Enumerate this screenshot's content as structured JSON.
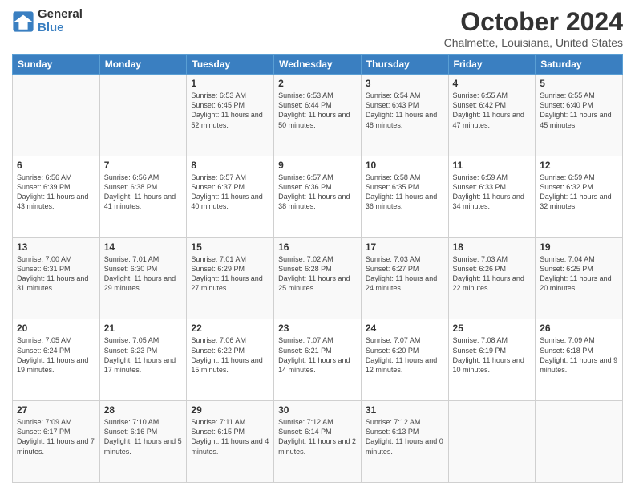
{
  "header": {
    "logo_general": "General",
    "logo_blue": "Blue",
    "month": "October 2024",
    "location": "Chalmette, Louisiana, United States"
  },
  "days_of_week": [
    "Sunday",
    "Monday",
    "Tuesday",
    "Wednesday",
    "Thursday",
    "Friday",
    "Saturday"
  ],
  "weeks": [
    [
      {
        "day": "",
        "info": ""
      },
      {
        "day": "",
        "info": ""
      },
      {
        "day": "1",
        "info": "Sunrise: 6:53 AM\nSunset: 6:45 PM\nDaylight: 11 hours and 52 minutes."
      },
      {
        "day": "2",
        "info": "Sunrise: 6:53 AM\nSunset: 6:44 PM\nDaylight: 11 hours and 50 minutes."
      },
      {
        "day": "3",
        "info": "Sunrise: 6:54 AM\nSunset: 6:43 PM\nDaylight: 11 hours and 48 minutes."
      },
      {
        "day": "4",
        "info": "Sunrise: 6:55 AM\nSunset: 6:42 PM\nDaylight: 11 hours and 47 minutes."
      },
      {
        "day": "5",
        "info": "Sunrise: 6:55 AM\nSunset: 6:40 PM\nDaylight: 11 hours and 45 minutes."
      }
    ],
    [
      {
        "day": "6",
        "info": "Sunrise: 6:56 AM\nSunset: 6:39 PM\nDaylight: 11 hours and 43 minutes."
      },
      {
        "day": "7",
        "info": "Sunrise: 6:56 AM\nSunset: 6:38 PM\nDaylight: 11 hours and 41 minutes."
      },
      {
        "day": "8",
        "info": "Sunrise: 6:57 AM\nSunset: 6:37 PM\nDaylight: 11 hours and 40 minutes."
      },
      {
        "day": "9",
        "info": "Sunrise: 6:57 AM\nSunset: 6:36 PM\nDaylight: 11 hours and 38 minutes."
      },
      {
        "day": "10",
        "info": "Sunrise: 6:58 AM\nSunset: 6:35 PM\nDaylight: 11 hours and 36 minutes."
      },
      {
        "day": "11",
        "info": "Sunrise: 6:59 AM\nSunset: 6:33 PM\nDaylight: 11 hours and 34 minutes."
      },
      {
        "day": "12",
        "info": "Sunrise: 6:59 AM\nSunset: 6:32 PM\nDaylight: 11 hours and 32 minutes."
      }
    ],
    [
      {
        "day": "13",
        "info": "Sunrise: 7:00 AM\nSunset: 6:31 PM\nDaylight: 11 hours and 31 minutes."
      },
      {
        "day": "14",
        "info": "Sunrise: 7:01 AM\nSunset: 6:30 PM\nDaylight: 11 hours and 29 minutes."
      },
      {
        "day": "15",
        "info": "Sunrise: 7:01 AM\nSunset: 6:29 PM\nDaylight: 11 hours and 27 minutes."
      },
      {
        "day": "16",
        "info": "Sunrise: 7:02 AM\nSunset: 6:28 PM\nDaylight: 11 hours and 25 minutes."
      },
      {
        "day": "17",
        "info": "Sunrise: 7:03 AM\nSunset: 6:27 PM\nDaylight: 11 hours and 24 minutes."
      },
      {
        "day": "18",
        "info": "Sunrise: 7:03 AM\nSunset: 6:26 PM\nDaylight: 11 hours and 22 minutes."
      },
      {
        "day": "19",
        "info": "Sunrise: 7:04 AM\nSunset: 6:25 PM\nDaylight: 11 hours and 20 minutes."
      }
    ],
    [
      {
        "day": "20",
        "info": "Sunrise: 7:05 AM\nSunset: 6:24 PM\nDaylight: 11 hours and 19 minutes."
      },
      {
        "day": "21",
        "info": "Sunrise: 7:05 AM\nSunset: 6:23 PM\nDaylight: 11 hours and 17 minutes."
      },
      {
        "day": "22",
        "info": "Sunrise: 7:06 AM\nSunset: 6:22 PM\nDaylight: 11 hours and 15 minutes."
      },
      {
        "day": "23",
        "info": "Sunrise: 7:07 AM\nSunset: 6:21 PM\nDaylight: 11 hours and 14 minutes."
      },
      {
        "day": "24",
        "info": "Sunrise: 7:07 AM\nSunset: 6:20 PM\nDaylight: 11 hours and 12 minutes."
      },
      {
        "day": "25",
        "info": "Sunrise: 7:08 AM\nSunset: 6:19 PM\nDaylight: 11 hours and 10 minutes."
      },
      {
        "day": "26",
        "info": "Sunrise: 7:09 AM\nSunset: 6:18 PM\nDaylight: 11 hours and 9 minutes."
      }
    ],
    [
      {
        "day": "27",
        "info": "Sunrise: 7:09 AM\nSunset: 6:17 PM\nDaylight: 11 hours and 7 minutes."
      },
      {
        "day": "28",
        "info": "Sunrise: 7:10 AM\nSunset: 6:16 PM\nDaylight: 11 hours and 5 minutes."
      },
      {
        "day": "29",
        "info": "Sunrise: 7:11 AM\nSunset: 6:15 PM\nDaylight: 11 hours and 4 minutes."
      },
      {
        "day": "30",
        "info": "Sunrise: 7:12 AM\nSunset: 6:14 PM\nDaylight: 11 hours and 2 minutes."
      },
      {
        "day": "31",
        "info": "Sunrise: 7:12 AM\nSunset: 6:13 PM\nDaylight: 11 hours and 0 minutes."
      },
      {
        "day": "",
        "info": ""
      },
      {
        "day": "",
        "info": ""
      }
    ]
  ]
}
